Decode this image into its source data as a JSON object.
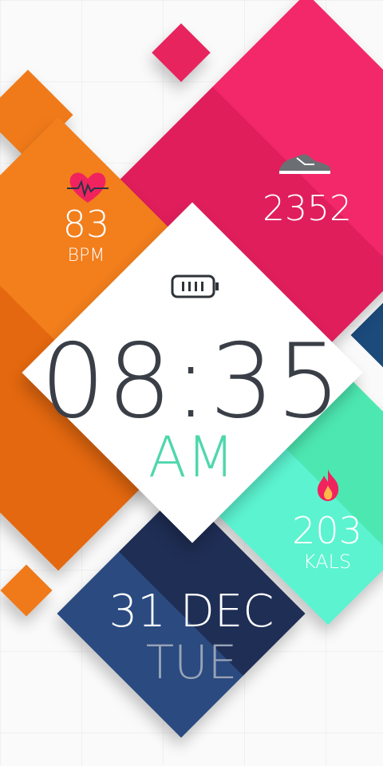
{
  "watchface": {
    "heart": {
      "value": "83",
      "unit": "BPM"
    },
    "steps": {
      "value": "2352"
    },
    "time": {
      "display": "08:35",
      "ampm": "AM"
    },
    "calories": {
      "value": "203",
      "unit": "KALS"
    },
    "date": {
      "day_month": "31 DEC",
      "weekday": "TUE"
    }
  },
  "icons": {
    "heart": "heart-rate-icon",
    "steps": "sneaker-icon",
    "battery": "battery-icon",
    "calories": "flame-icon"
  },
  "colors": {
    "orange": "#f07a1a",
    "orange_dark": "#e3660f",
    "pink": "#f0235f",
    "pink_dark": "#e01d5a",
    "teal": "#58efc6",
    "teal_dark": "#4fe6b4",
    "navy": "#263e6e",
    "navy_dark": "#1f2f56",
    "blue_accent": "#1b4a7b",
    "text_dark": "#3a3f47",
    "am_green": "#4fd7ad",
    "white": "#ffffff"
  }
}
